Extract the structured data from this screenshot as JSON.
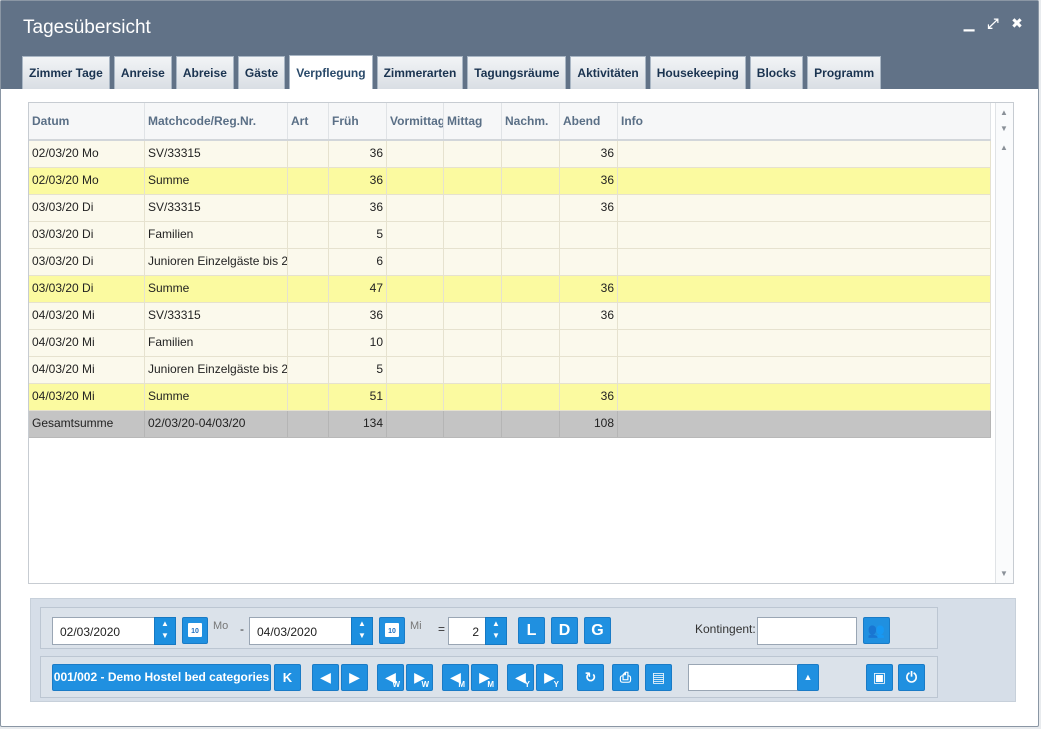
{
  "window": {
    "title": "Tagesübersicht",
    "controls": {
      "minimize": "▁",
      "maximize": "⤢",
      "close": "✖"
    }
  },
  "tabs": [
    {
      "label": "Zimmer Tage",
      "active": false
    },
    {
      "label": "Anreise",
      "active": false
    },
    {
      "label": "Abreise",
      "active": false
    },
    {
      "label": "Gäste",
      "active": false
    },
    {
      "label": "Verpflegung",
      "active": true
    },
    {
      "label": "Zimmerarten",
      "active": false
    },
    {
      "label": "Tagungsräume",
      "active": false
    },
    {
      "label": "Aktivitäten",
      "active": false
    },
    {
      "label": "Housekeeping",
      "active": false
    },
    {
      "label": "Blocks",
      "active": false
    },
    {
      "label": "Programm",
      "active": false
    }
  ],
  "grid": {
    "columns": [
      "Datum",
      "Matchcode/Reg.Nr.",
      "Art",
      "Früh",
      "Vormittag",
      "Mittag",
      "Nachm.",
      "Abend",
      "Info"
    ],
    "rows": [
      {
        "type": "normal",
        "cells": [
          "02/03/20 Mo",
          "SV/33315",
          "",
          "36",
          "",
          "",
          "",
          "36",
          ""
        ]
      },
      {
        "type": "sum",
        "cells": [
          "02/03/20 Mo",
          "Summe",
          "",
          "36",
          "",
          "",
          "",
          "36",
          ""
        ]
      },
      {
        "type": "normal",
        "cells": [
          "03/03/20 Di",
          "SV/33315",
          "",
          "36",
          "",
          "",
          "",
          "36",
          ""
        ]
      },
      {
        "type": "normal",
        "cells": [
          "03/03/20 Di",
          "Familien",
          "",
          "5",
          "",
          "",
          "",
          "",
          ""
        ]
      },
      {
        "type": "normal",
        "cells": [
          "03/03/20 Di",
          "Junioren Einzelgäste bis 2",
          "",
          "6",
          "",
          "",
          "",
          "",
          ""
        ]
      },
      {
        "type": "sum",
        "cells": [
          "03/03/20 Di",
          "Summe",
          "",
          "47",
          "",
          "",
          "",
          "36",
          ""
        ]
      },
      {
        "type": "normal",
        "cells": [
          "04/03/20 Mi",
          "SV/33315",
          "",
          "36",
          "",
          "",
          "",
          "36",
          ""
        ]
      },
      {
        "type": "normal",
        "cells": [
          "04/03/20 Mi",
          "Familien",
          "",
          "10",
          "",
          "",
          "",
          "",
          ""
        ]
      },
      {
        "type": "normal",
        "cells": [
          "04/03/20 Mi",
          "Junioren Einzelgäste bis 2",
          "",
          "5",
          "",
          "",
          "",
          "",
          ""
        ]
      },
      {
        "type": "sum",
        "cells": [
          "04/03/20 Mi",
          "Summe",
          "",
          "51",
          "",
          "",
          "",
          "36",
          ""
        ]
      },
      {
        "type": "total",
        "cells": [
          "Gesamtsumme",
          "02/03/20-04/03/20",
          "",
          "134",
          "",
          "",
          "",
          "108",
          ""
        ]
      }
    ]
  },
  "controls": {
    "date_from": "02/03/2020",
    "day_from": "Mo",
    "separator": "-",
    "date_to": "04/03/2020",
    "day_to": "Mi",
    "equals": "=",
    "days_count": "2",
    "btn_l": "L",
    "btn_d": "D",
    "btn_g": "G",
    "kontingent_label": "Kontingent:",
    "kontingent_value": "",
    "category_button": "001/002 - Demo Hostel bed categories",
    "btn_k": "K",
    "nav_w": "W",
    "nav_m": "M",
    "nav_y": "Y",
    "select_value": ""
  }
}
